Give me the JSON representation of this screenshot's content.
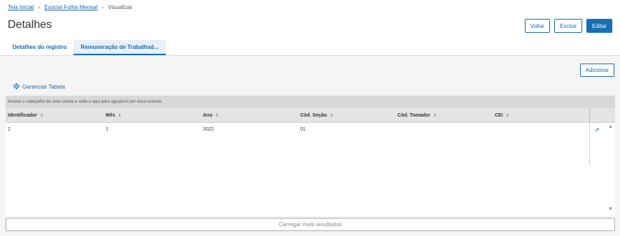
{
  "breadcrumb": {
    "home": "Tela Inicial",
    "section": "Esocial Folha Mensal",
    "current": "Visualizar"
  },
  "page": {
    "title": "Detalhes"
  },
  "actions": {
    "back": "Voltar",
    "delete": "Excluir",
    "edit": "Editar"
  },
  "tabs": [
    {
      "label": "Detalhes do registro"
    },
    {
      "label": "Remuneração de Trabalhad..."
    }
  ],
  "grid_actions": {
    "add": "Adicionar",
    "manage": "Gerenciar Tabela"
  },
  "table": {
    "group_hint": "Arraste o cabeçalho de uma coluna e solte-o aqui para agrupá-lo por essa colunas.",
    "columns": [
      "Identificador",
      "Mês",
      "Ano",
      "Cód. Seção",
      "Cód. Tomador",
      "CEI"
    ],
    "rows": [
      [
        "2",
        "1",
        "2022",
        "01",
        "",
        ""
      ]
    ]
  },
  "footer": {
    "load_more": "Carregar mais resultados"
  },
  "colors": {
    "accent": "#1670b5",
    "link": "#1a6aa8",
    "header_bg": "#e4e4e4",
    "group_bg": "#d8d8d8"
  }
}
